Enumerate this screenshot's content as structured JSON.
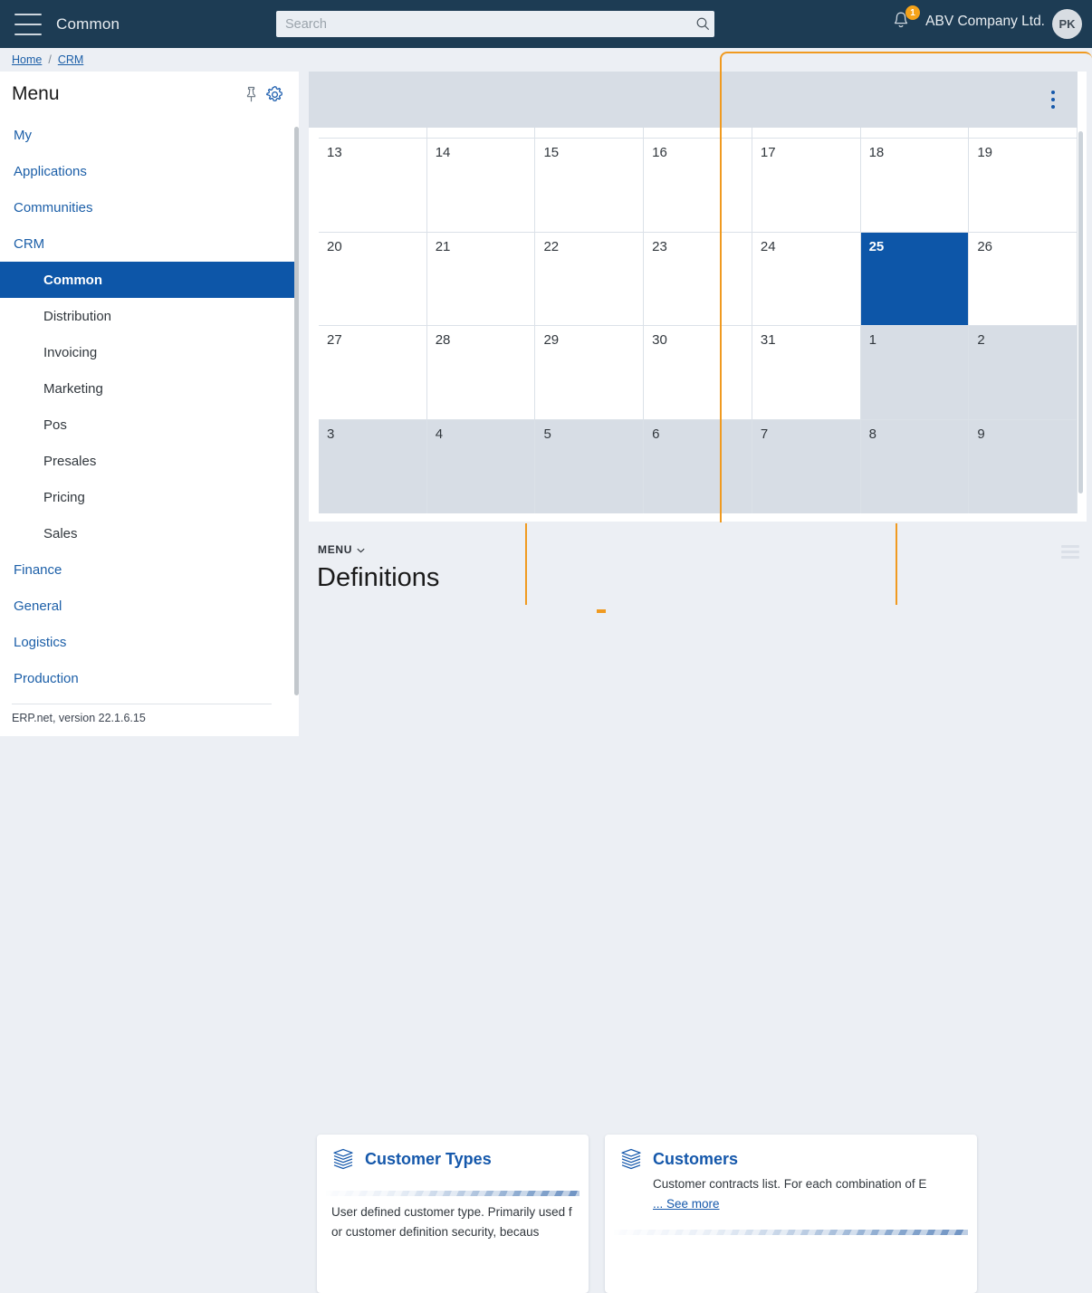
{
  "header": {
    "menu_icon": "hamburger-icon",
    "app_title": "Common",
    "search": {
      "value": "",
      "placeholder": "Search",
      "icon": "search-icon"
    },
    "notifications": {
      "icon": "bell-icon",
      "count": "1",
      "badge_color": "#f5a31a"
    },
    "company": "ABV Company Ltd.",
    "avatar_initials": "PK",
    "background_color": "#1d3c54"
  },
  "breadcrumb": {
    "items": [
      "Home",
      "CRM"
    ],
    "separator": "/"
  },
  "sidebar": {
    "title": "Menu",
    "pin_icon": "pin-icon",
    "settings_icon": "gear-icon",
    "items": [
      {
        "label": "My",
        "level": 1,
        "active": false
      },
      {
        "label": "Applications",
        "level": 1,
        "active": false
      },
      {
        "label": "Communities",
        "level": 1,
        "active": false
      },
      {
        "label": "CRM",
        "level": 1,
        "active": false
      },
      {
        "label": "Common",
        "level": 2,
        "active": true
      },
      {
        "label": "Distribution",
        "level": 2,
        "active": false
      },
      {
        "label": "Invoicing",
        "level": 2,
        "active": false
      },
      {
        "label": "Marketing",
        "level": 2,
        "active": false
      },
      {
        "label": "Pos",
        "level": 2,
        "active": false
      },
      {
        "label": "Presales",
        "level": 2,
        "active": false
      },
      {
        "label": "Pricing",
        "level": 2,
        "active": false
      },
      {
        "label": "Sales",
        "level": 2,
        "active": false
      },
      {
        "label": "Finance",
        "level": 1,
        "active": false
      },
      {
        "label": "General",
        "level": 1,
        "active": false
      },
      {
        "label": "Logistics",
        "level": 1,
        "active": false
      },
      {
        "label": "Production",
        "level": 1,
        "active": false
      }
    ],
    "footer": "ERP.net, version 22.1.6.15",
    "active_color": "#0d56a8"
  },
  "calendar": {
    "kebab_icon": "more-vertical-icon",
    "selected_day": "25",
    "weeks": [
      [
        {
          "d": "13",
          "other": false
        },
        {
          "d": "14",
          "other": false
        },
        {
          "d": "15",
          "other": false
        },
        {
          "d": "16",
          "other": false
        },
        {
          "d": "17",
          "other": false
        },
        {
          "d": "18",
          "other": false
        },
        {
          "d": "19",
          "other": false
        }
      ],
      [
        {
          "d": "20",
          "other": false
        },
        {
          "d": "21",
          "other": false
        },
        {
          "d": "22",
          "other": false
        },
        {
          "d": "23",
          "other": false
        },
        {
          "d": "24",
          "other": false
        },
        {
          "d": "25",
          "other": false,
          "selected": true
        },
        {
          "d": "26",
          "other": false
        }
      ],
      [
        {
          "d": "27",
          "other": false
        },
        {
          "d": "28",
          "other": false
        },
        {
          "d": "29",
          "other": false
        },
        {
          "d": "30",
          "other": false
        },
        {
          "d": "31",
          "other": false
        },
        {
          "d": "1",
          "other": true
        },
        {
          "d": "2",
          "other": true
        }
      ],
      [
        {
          "d": "3",
          "other": true
        },
        {
          "d": "4",
          "other": true
        },
        {
          "d": "5",
          "other": true
        },
        {
          "d": "6",
          "other": true
        },
        {
          "d": "7",
          "other": true
        },
        {
          "d": "8",
          "other": true
        },
        {
          "d": "9",
          "other": true
        }
      ]
    ]
  },
  "definitions": {
    "menu_label": "MENU",
    "menu_chevron": "chevron-down-icon",
    "title": "Definitions",
    "list_icon": "list-view-icon",
    "cards": [
      {
        "icon": "stacked-layers-icon",
        "title": "Customer Types",
        "description": "User defined customer type. Primarily used for customer definition security, becaus"
      },
      {
        "icon": "stacked-layers-icon",
        "title": "Customers",
        "description": "Customer contracts list. For each combination of E",
        "see_more": "... See more"
      }
    ]
  },
  "theme": {
    "accent_orange": "#f09a20",
    "accent_blue": "#1558ab",
    "panel_gray": "#d7dde5"
  }
}
